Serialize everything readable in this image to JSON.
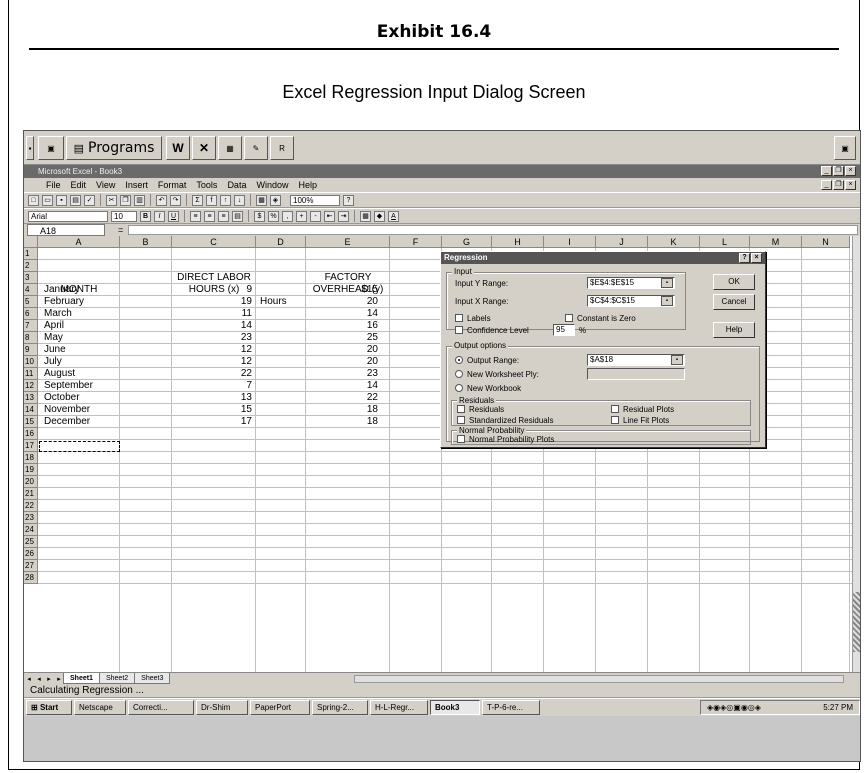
{
  "exhibit": {
    "title": "Exhibit 16.4",
    "subtitle": "Excel Regression Input Dialog Screen"
  },
  "office_bar": {
    "programs_label": "Programs"
  },
  "window": {
    "title": "Microsoft Excel - Book3"
  },
  "menu": [
    "File",
    "Edit",
    "View",
    "Insert",
    "Format",
    "Tools",
    "Data",
    "Window",
    "Help"
  ],
  "toolbar": {
    "zoom": "100%",
    "font": "Arial",
    "size": "10"
  },
  "name_box": "A18",
  "formula_eq": "=",
  "columns": [
    "A",
    "B",
    "C",
    "D",
    "E",
    "F",
    "G",
    "H",
    "I",
    "J",
    "K",
    "L",
    "M",
    "N"
  ],
  "rows": [
    "1",
    "2",
    "3",
    "4",
    "5",
    "6",
    "7",
    "8",
    "9",
    "10",
    "11",
    "12",
    "13",
    "14",
    "15",
    "16",
    "17",
    "18",
    "19",
    "20",
    "21",
    "22",
    "23",
    "24",
    "25",
    "26",
    "27",
    "28"
  ],
  "sheet": {
    "header_c2": "DIRECT LABOR",
    "header_c3": "HOURS (x)",
    "header_e2": "FACTORY",
    "header_e3": "OVERHEAD (y)",
    "header_a3": "MONTH",
    "hours_label": "Hours",
    "data": [
      {
        "month": "January",
        "hours": "9",
        "overhead": "$15"
      },
      {
        "month": "February",
        "hours": "19",
        "overhead": "20"
      },
      {
        "month": "March",
        "hours": "11",
        "overhead": "14"
      },
      {
        "month": "April",
        "hours": "14",
        "overhead": "16"
      },
      {
        "month": "May",
        "hours": "23",
        "overhead": "25"
      },
      {
        "month": "June",
        "hours": "12",
        "overhead": "20"
      },
      {
        "month": "July",
        "hours": "12",
        "overhead": "20"
      },
      {
        "month": "August",
        "hours": "22",
        "overhead": "23"
      },
      {
        "month": "September",
        "hours": "7",
        "overhead": "14"
      },
      {
        "month": "October",
        "hours": "13",
        "overhead": "22"
      },
      {
        "month": "November",
        "hours": "15",
        "overhead": "18"
      },
      {
        "month": "December",
        "hours": "17",
        "overhead": "18"
      }
    ]
  },
  "sheet_tabs": [
    "Sheet1",
    "Sheet2",
    "Sheet3"
  ],
  "status": "Calculating Regression ...",
  "taskbar": {
    "start": "Start",
    "items": [
      "Netscape",
      "Correcti...",
      "Dr-Shim",
      "PaperPort",
      "Spring-2...",
      "H-L-Regr...",
      "Book3",
      "T-P-6-re..."
    ],
    "clock": "5:27 PM"
  },
  "dialog": {
    "title": "Regression",
    "input_group": "Input",
    "input_y_label": "Input Y Range:",
    "input_y_value": "$E$4:$E$15",
    "input_x_label": "Input X Range:",
    "input_x_value": "$C$4:$C$15",
    "labels_label": "Labels",
    "constant_zero_label": "Constant is Zero",
    "confidence_label": "Confidence Level",
    "confidence_value": "95",
    "confidence_unit": "%",
    "output_group": "Output options",
    "output_range_label": "Output Range:",
    "output_range_value": "$A$18",
    "new_worksheet_label": "New Worksheet Ply:",
    "new_workbook_label": "New Workbook",
    "residuals_group": "Residuals",
    "residuals_label": "Residuals",
    "std_residuals_label": "Standardized Residuals",
    "residual_plots_label": "Residual Plots",
    "line_fit_label": "Line Fit Plots",
    "normal_group": "Normal Probability",
    "normal_plots_label": "Normal Probability Plots",
    "ok": "OK",
    "cancel": "Cancel",
    "help": "Help"
  }
}
